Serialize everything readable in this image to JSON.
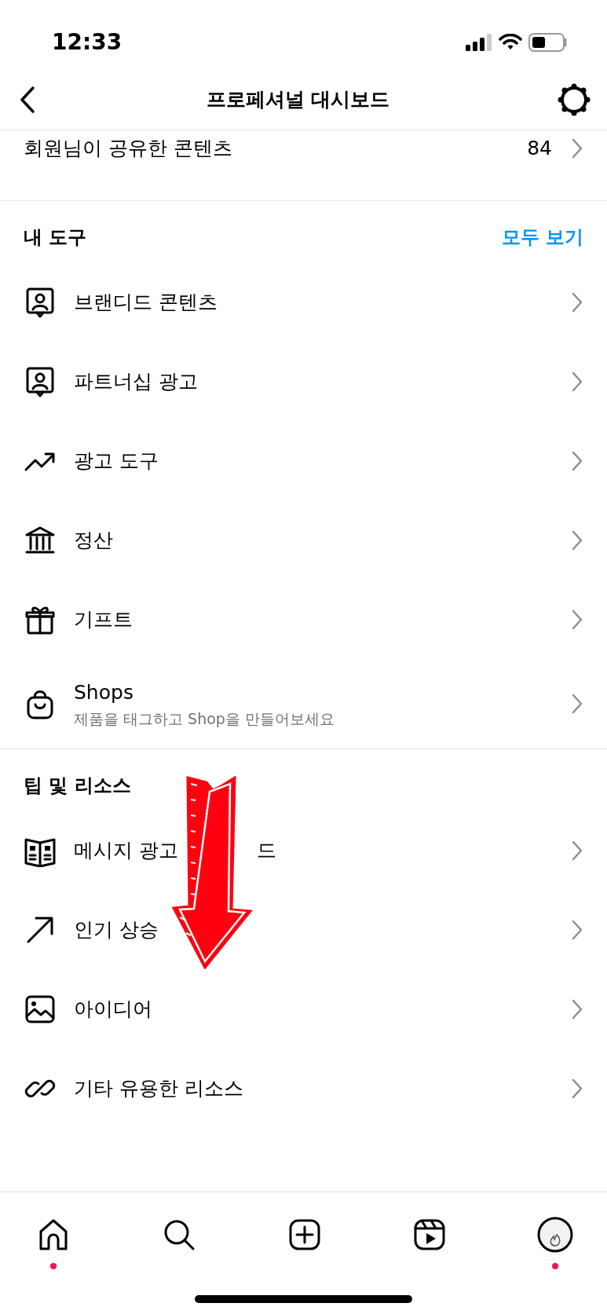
{
  "status_bar": {
    "time": "12:33"
  },
  "header": {
    "title": "프로페셔널 대시보드"
  },
  "shared_row": {
    "label": "회원님이 공유한 콘텐츠",
    "count": "84"
  },
  "my_tools": {
    "title": "내 도구",
    "see_all": "모두 보기",
    "items": [
      {
        "kind": "person-card",
        "title": "브랜디드 콘텐츠"
      },
      {
        "kind": "person-card",
        "title": "파트너십 광고"
      },
      {
        "kind": "trend",
        "title": "광고 도구"
      },
      {
        "kind": "bank",
        "title": "정산"
      },
      {
        "kind": "gift",
        "title": "기프트"
      },
      {
        "kind": "bag",
        "title": "Shops",
        "subtitle": "제품을 태그하고 Shop을 만들어보세요"
      }
    ]
  },
  "tips": {
    "title": "팁 및 리소스",
    "items": [
      {
        "kind": "book",
        "title": "메시지 광고",
        "tail": "드"
      },
      {
        "kind": "arrow",
        "title": "인기 상승"
      },
      {
        "kind": "image",
        "title": "아이디어"
      },
      {
        "kind": "link",
        "title": "기타 유용한 리소스"
      }
    ]
  },
  "tab_bar": [
    {
      "kind": "home",
      "notification": true
    },
    {
      "kind": "search",
      "notification": false
    },
    {
      "kind": "create",
      "notification": false
    },
    {
      "kind": "reels",
      "notification": false
    },
    {
      "kind": "profile",
      "notification": true
    }
  ]
}
